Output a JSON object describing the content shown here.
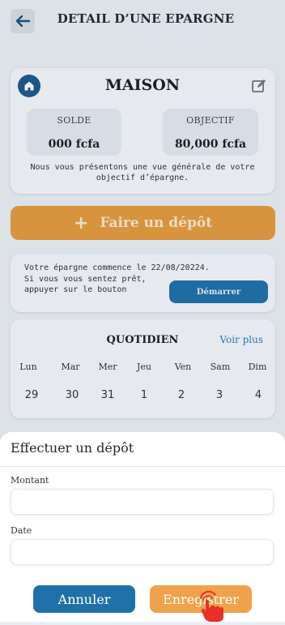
{
  "header": {
    "title": "DETAIL D’UNE EPARGNE"
  },
  "summary": {
    "goal_name": "MAISON",
    "balance_label": "SOLDE",
    "balance_value": "000 fcfa",
    "target_label": "OBJECTIF",
    "target_value": "80,000 fcfa",
    "overview_line1": "Nous vous présentons une vue générale de votre",
    "overview_line2": "objectif d’épargne."
  },
  "deposit_cta": {
    "plus": "+",
    "label": "Faire un dépôt"
  },
  "start_card": {
    "line1": "Votre épargne commence le 22/08/20224.",
    "line2": "Si vous vous sentez prêt,",
    "line3": "appuyer sur le bouton",
    "button_label": "Démarrer"
  },
  "calendar": {
    "title": "QUOTIDIEN",
    "see_more": "Voir plus",
    "days": [
      {
        "name": "Lun",
        "num": "29"
      },
      {
        "name": "Mar",
        "num": "30"
      },
      {
        "name": "Mer",
        "num": "31"
      },
      {
        "name": "Jeu",
        "num": "1"
      },
      {
        "name": "Ven",
        "num": "2"
      },
      {
        "name": "Sam",
        "num": "3"
      },
      {
        "name": "Dim",
        "num": "4"
      }
    ]
  },
  "sheet": {
    "title": "Effectuer un dépôt",
    "amount_label": "Montant",
    "amount_value": "",
    "date_label": "Date",
    "date_value": "",
    "cancel_label": "Annuler",
    "save_label": "Enregistrer"
  },
  "colors": {
    "accent_blue": "#2071a9",
    "accent_orange": "#f0a24a",
    "overlay": "rgba(0,0,0,0.08)"
  }
}
